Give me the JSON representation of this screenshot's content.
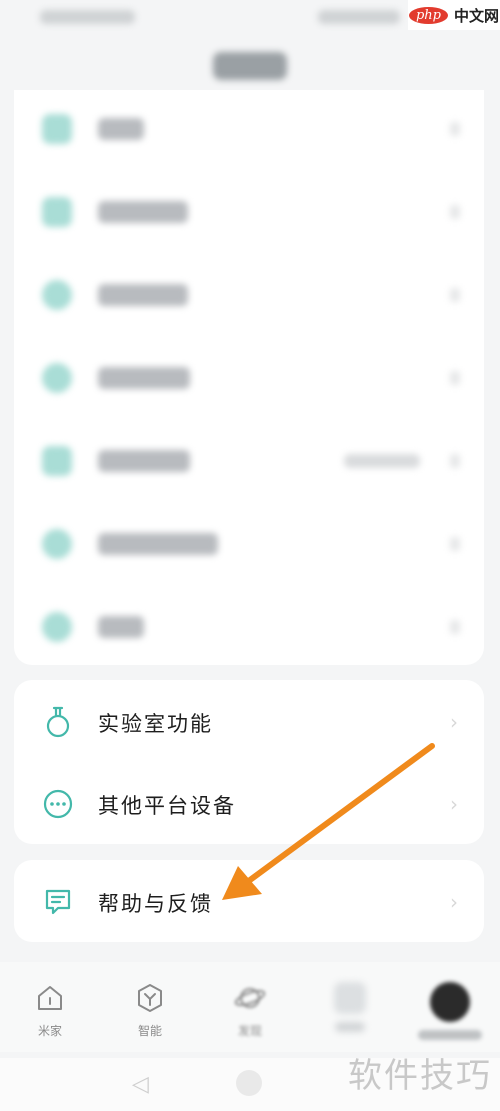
{
  "header": {
    "php_logo": "php",
    "php_site": "中文网"
  },
  "menu_group_1": [
    {
      "icon": "blurred-icon"
    },
    {
      "icon": "blurred-icon"
    },
    {
      "icon": "blurred-icon"
    },
    {
      "icon": "blurred-icon"
    },
    {
      "icon": "blurred-icon"
    },
    {
      "icon": "blurred-icon"
    },
    {
      "icon": "blurred-icon"
    }
  ],
  "menu_group_2": [
    {
      "label": "实验室功能",
      "icon": "flask-icon"
    },
    {
      "label": "其他平台设备",
      "icon": "more-dots-icon"
    }
  ],
  "menu_group_3": [
    {
      "label": "帮助与反馈",
      "icon": "feedback-icon"
    }
  ],
  "bottom_nav": [
    {
      "label": "米家",
      "icon": "home-icon"
    },
    {
      "label": "智能",
      "icon": "smart-icon"
    },
    {
      "label": "发现",
      "icon": "planet-icon"
    }
  ],
  "watermark": "软件技巧",
  "colors": {
    "accent": "#43b8aa",
    "arrow": "#f08a1c"
  }
}
